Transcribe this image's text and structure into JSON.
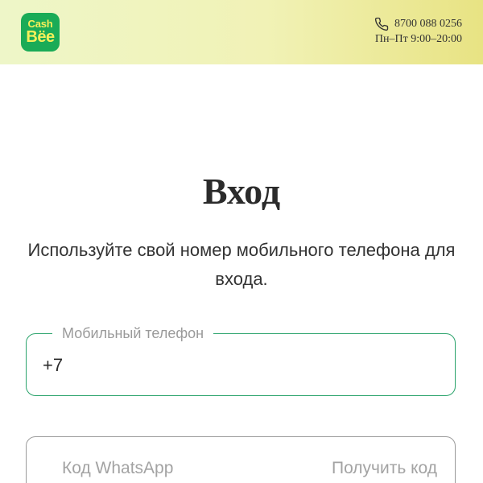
{
  "header": {
    "logo": {
      "line1": "Cash",
      "line2": "Bёe"
    },
    "contact": {
      "phone": "8700 088 0256",
      "hours": "Пн–Пт 9:00–20:00"
    }
  },
  "main": {
    "title": "Вход",
    "subtitle": "Используйте свой номер мобильного телефона для входа."
  },
  "form": {
    "phone_field": {
      "label": "Мобильный телефон",
      "value": "+7"
    },
    "code_field": {
      "placeholder": "Код WhatsApp",
      "action_label": "Получить код"
    }
  },
  "colors": {
    "brand_green": "#1aab57",
    "brand_yellow": "#f6ef5a",
    "active_border": "#2aa36b"
  }
}
